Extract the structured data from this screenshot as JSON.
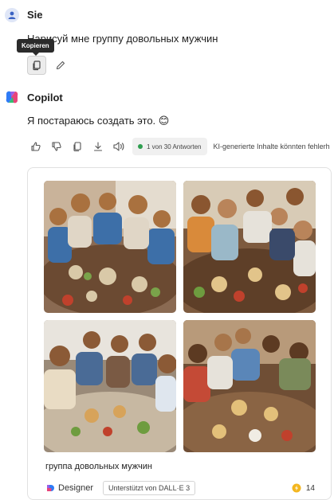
{
  "user": {
    "name": "Sie",
    "message": "Нарисуй мне группу довольных мужчин"
  },
  "tooltip": {
    "label": "Kopieren"
  },
  "copilot": {
    "name": "Copilot",
    "reply": "Я постараюсь создать это. 😊",
    "answer_counter": "1 von 30 Antworten",
    "disclaimer": "KI-generierte Inhalte könnten fehlerh"
  },
  "image_card": {
    "caption": "группа довольных мужчин",
    "designer_label": "Designer",
    "dalle_label": "Unterstützt von DALL·E 3",
    "boost_count": "14"
  },
  "colors": {
    "accent_green": "#2e9e4f",
    "tooltip_bg": "#2b2b2b"
  }
}
